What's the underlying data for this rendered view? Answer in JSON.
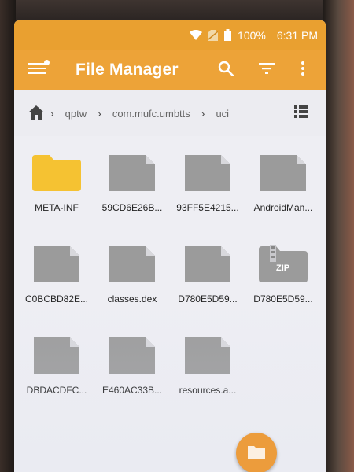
{
  "status_bar": {
    "battery": "100%",
    "time": "6:31 PM"
  },
  "app_bar": {
    "title": "File Manager",
    "icons": [
      "menu-icon",
      "search-icon",
      "filter-icon",
      "more-vert-icon"
    ]
  },
  "breadcrumb": {
    "items": [
      "qptw",
      "com.mufc.umbtts",
      "uci"
    ]
  },
  "files": [
    {
      "name": "META-INF",
      "type": "folder"
    },
    {
      "name": "59CD6E26B...",
      "type": "file"
    },
    {
      "name": "93FF5E4215...",
      "type": "file"
    },
    {
      "name": "AndroidMan...",
      "type": "file"
    },
    {
      "name": "C0BCBD82E...",
      "type": "file"
    },
    {
      "name": "classes.dex",
      "type": "file"
    },
    {
      "name": "D780E5D59...",
      "type": "file"
    },
    {
      "name": "D780E5D59...",
      "type": "zip",
      "badge": "ZIP"
    },
    {
      "name": "DBDACDFC...",
      "type": "file"
    },
    {
      "name": "E460AC33B...",
      "type": "file"
    },
    {
      "name": "resources.a...",
      "type": "file"
    }
  ],
  "colors": {
    "accent": "#eda338",
    "folder": "#f5c232",
    "file": "#9b9b9b"
  }
}
